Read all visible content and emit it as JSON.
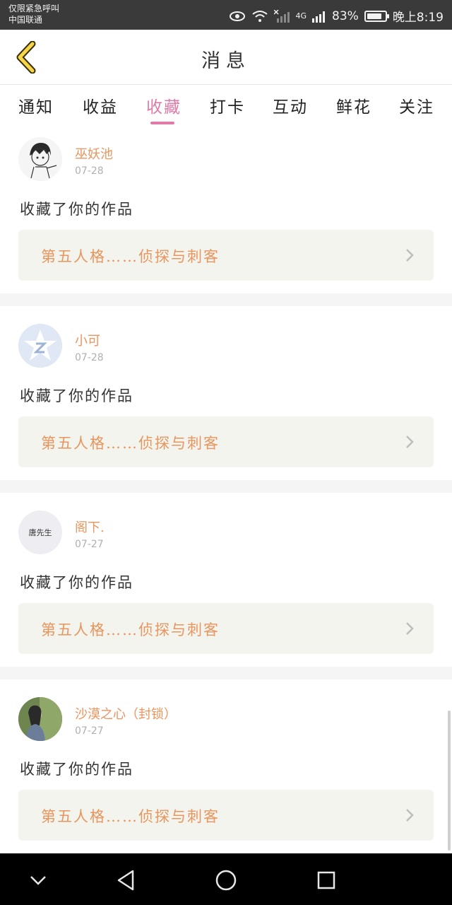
{
  "status_bar": {
    "line1": "仅限紧急呼叫",
    "line2": "中国联通",
    "network": "4G",
    "battery_percent": "83%",
    "battery_level": 0.83,
    "time": "晚上8:19"
  },
  "header": {
    "title": "消息"
  },
  "tabs": [
    {
      "label": "通知"
    },
    {
      "label": "收益"
    },
    {
      "label": "收藏"
    },
    {
      "label": "打卡"
    },
    {
      "label": "互动"
    },
    {
      "label": "鲜花"
    },
    {
      "label": "关注"
    }
  ],
  "active_tab": "收藏",
  "items": [
    {
      "username": "巫妖池",
      "date": "07-28",
      "action": "收藏了你的作品",
      "work": "第五人格……侦探与刺客",
      "avatar": "sketch-boy-avatar"
    },
    {
      "username": "小可",
      "date": "07-28",
      "action": "收藏了你的作品",
      "work": "第五人格……侦探与刺客",
      "avatar": "qzone-star-avatar"
    },
    {
      "username": "阁下.",
      "date": "07-27",
      "action": "收藏了你的作品",
      "work": "第五人格……侦探与刺客",
      "avatar": "text-avatar",
      "avatar_text": "唐先生"
    },
    {
      "username": "沙漠之心（封锁）",
      "date": "07-27",
      "action": "收藏了你的作品",
      "work": "第五人格……侦探与刺客",
      "avatar": "photo-avatar"
    }
  ],
  "colors": {
    "accent_pink": "#e07aa8",
    "orange_text": "#e8955e",
    "work_box_bg": "#f4f4ef",
    "status_bar_bg": "#3a3a3a",
    "nav_bar_bg": "#000000"
  }
}
